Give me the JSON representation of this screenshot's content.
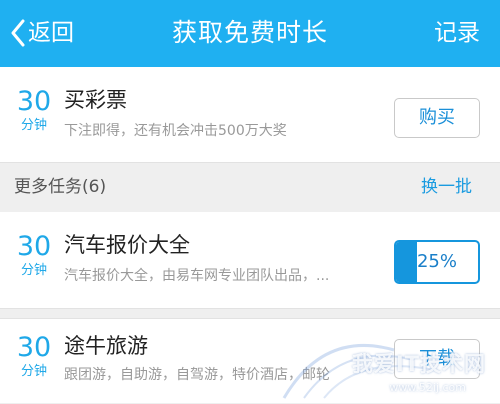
{
  "navbar": {
    "back_label": "返回",
    "title": "获取免费时长",
    "record_label": "记录",
    "background": "#1fb0f1"
  },
  "featured_task": {
    "reward_number": "30",
    "reward_unit": "分钟",
    "title": "买彩票",
    "description": "下注即得，还有机会冲击500万大奖",
    "action_label": "购买"
  },
  "more_tasks": {
    "header": "更多任务(6)",
    "refresh_label": "换一批",
    "items": [
      {
        "reward_number": "30",
        "reward_unit": "分钟",
        "title": "汽车报价大全",
        "description": "汽车报价大全，由易车网专业团队出品，...",
        "progress_label": "25%",
        "progress": 0.25
      },
      {
        "reward_number": "30",
        "reward_unit": "分钟",
        "title": "途牛旅游",
        "description": "跟团游，自助游，自驾游，特价酒店，邮轮",
        "action_label": "下载"
      }
    ]
  },
  "watermark": {
    "text": "我爱IT技术网",
    "url": "www.52ij.com"
  },
  "colors": {
    "accent": "#1fa8e8",
    "progress": "#1596dd",
    "background": "#efefef"
  }
}
